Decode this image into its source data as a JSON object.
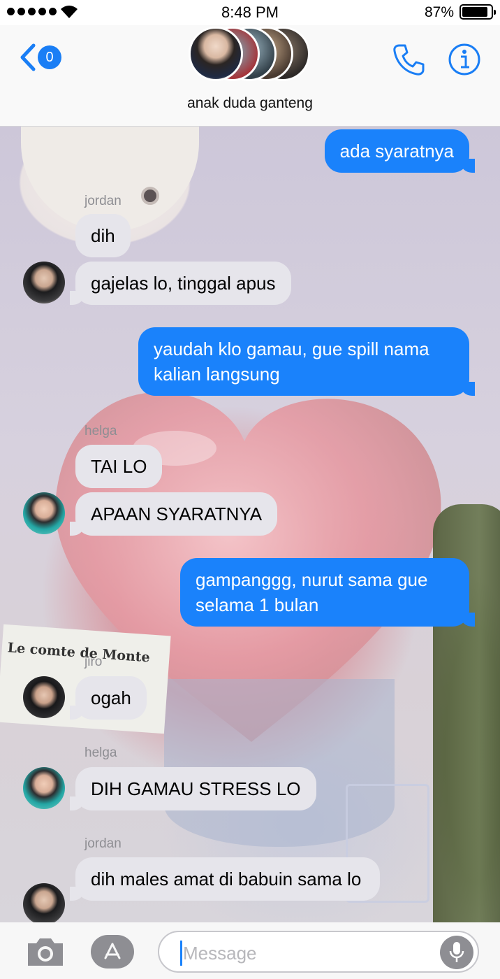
{
  "status_bar": {
    "time": "8:48 PM",
    "battery": "87%"
  },
  "header": {
    "back_count": "0",
    "group_name": "anak duda ganteng"
  },
  "messages": [
    {
      "type": "out",
      "text": "ada syaratnya"
    },
    {
      "type": "sender",
      "text": "jordan"
    },
    {
      "type": "in",
      "text": "dih"
    },
    {
      "type": "in",
      "text": "gajelas lo, tinggal apus"
    },
    {
      "type": "out",
      "text": "yaudah klo gamau, gue spill nama kalian langsung"
    },
    {
      "type": "sender",
      "text": "helga"
    },
    {
      "type": "in",
      "text": "TAI LO"
    },
    {
      "type": "in",
      "text": "APAAN SYARATNYA"
    },
    {
      "type": "out",
      "text": "gampanggg, nurut sama gue selama 1 bulan"
    },
    {
      "type": "sender",
      "text": "jiro"
    },
    {
      "type": "in",
      "text": "ogah"
    },
    {
      "type": "sender",
      "text": "helga"
    },
    {
      "type": "in",
      "text": "DIH GAMAU STRESS LO"
    },
    {
      "type": "sender",
      "text": "jordan"
    },
    {
      "type": "in",
      "text": "dih males amat di babuin sama lo"
    }
  ],
  "background": {
    "book_text": "Le comte de Monte"
  },
  "composer": {
    "placeholder": "Message"
  },
  "colors": {
    "accent": "#1a82fb",
    "incoming_bubble": "#e6e5eb"
  },
  "icons": [
    "back-chevron-icon",
    "phone-icon",
    "info-icon",
    "camera-icon",
    "app-store-icon",
    "microphone-icon",
    "wifi-icon",
    "battery-icon"
  ]
}
